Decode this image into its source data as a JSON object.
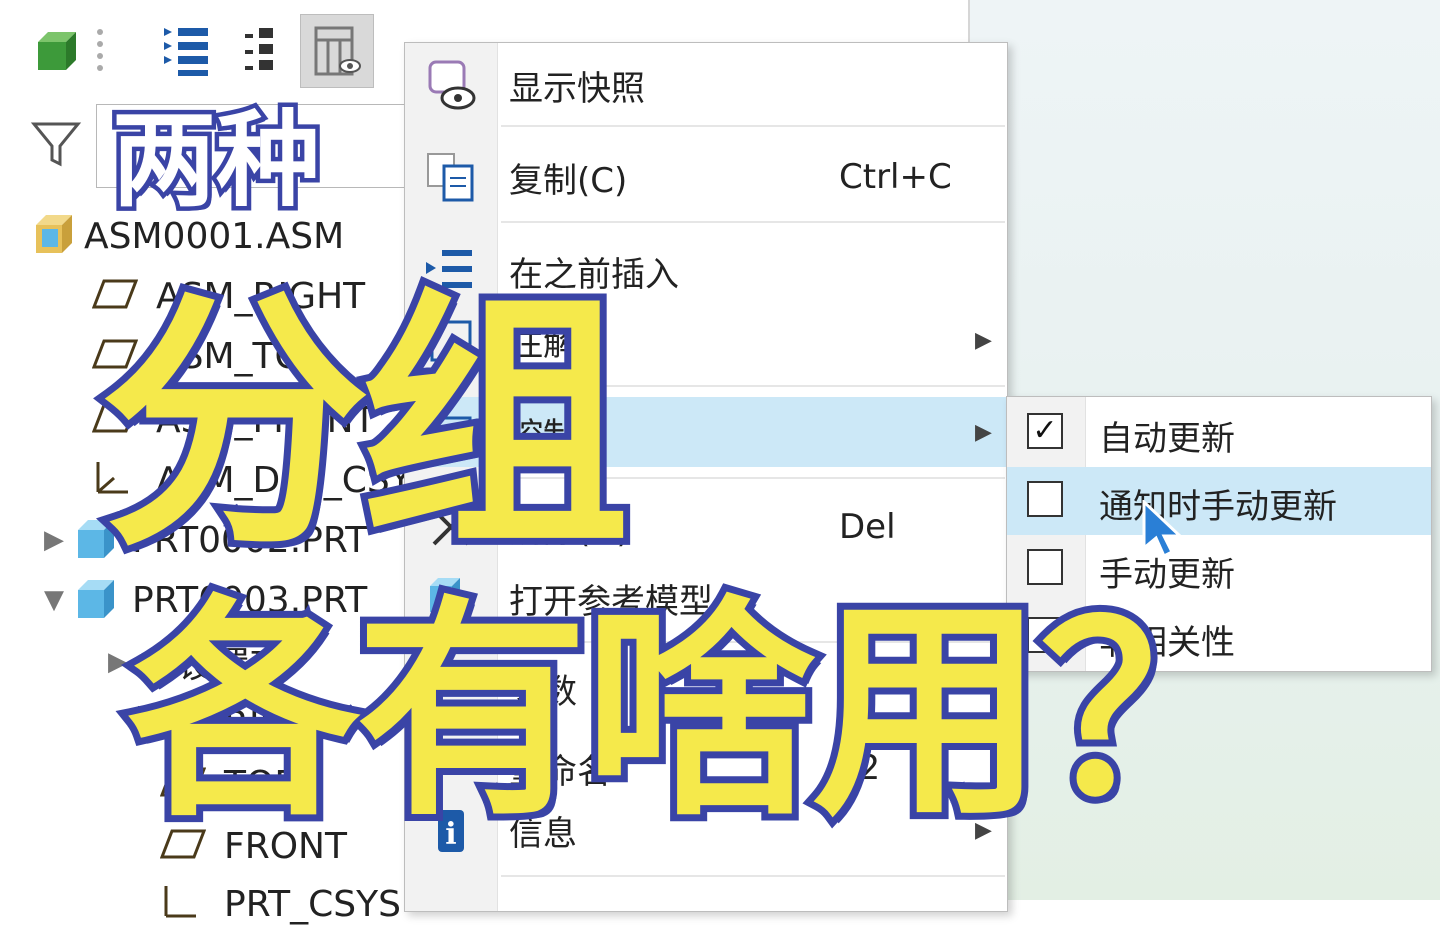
{
  "tree": {
    "items": [
      {
        "label": "ASM0001.ASM"
      },
      {
        "label": "ASM_RIGHT"
      },
      {
        "label": "ASM_TOP"
      },
      {
        "label": "ASM_FRONT"
      },
      {
        "label": "ASM_DEF_CSYS"
      },
      {
        "label": "PRT0002.PRT"
      },
      {
        "label": "PRT0003.PRT"
      },
      {
        "label": "设置项"
      },
      {
        "label": "RIGHT"
      },
      {
        "label": "TOP"
      },
      {
        "label": "FRONT"
      },
      {
        "label": "PRT_CSYS"
      }
    ]
  },
  "context_menu": {
    "items": [
      {
        "label": "显示快照",
        "shortcut": ""
      },
      {
        "label": "复制(C)",
        "shortcut": "Ctrl+C"
      },
      {
        "label": "在之前插入",
        "shortcut": ""
      },
      {
        "label": "注解",
        "shortcut": ""
      },
      {
        "label": "控制",
        "shortcut": ""
      },
      {
        "label": "删除(D)",
        "shortcut": "Del"
      },
      {
        "label": "打开参考模型",
        "shortcut": ""
      },
      {
        "label": "参数",
        "shortcut": ""
      },
      {
        "label": "重命名",
        "shortcut": "F2"
      },
      {
        "label": "信息",
        "shortcut": ""
      }
    ]
  },
  "submenu": {
    "items": [
      {
        "label": "自动更新",
        "checked": true
      },
      {
        "label": "通知时手动更新",
        "checked": false
      },
      {
        "label": "手动更新",
        "checked": false
      },
      {
        "label": "非相关性",
        "checked": false
      }
    ]
  },
  "overlay": {
    "line1": "两种",
    "line2": "分组",
    "line3": "各有啥用？"
  },
  "colors": {
    "overlay_yellow": "#f5e94b",
    "overlay_outline": "#3a44a6",
    "menu_highlight": "#cce8f7"
  }
}
